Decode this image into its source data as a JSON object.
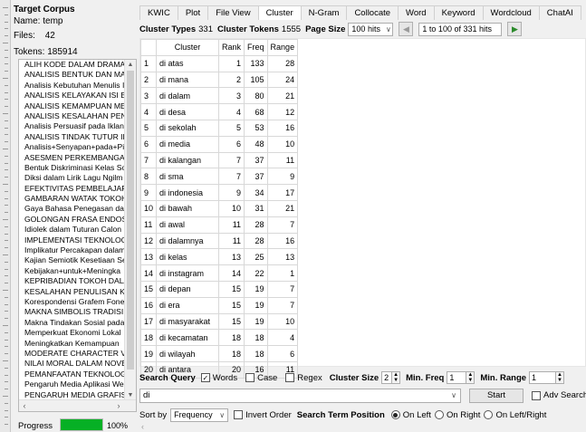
{
  "corpus": {
    "title": "Target Corpus",
    "name_label": "Name:",
    "name_value": "temp",
    "files_label": "Files:",
    "files_value": "42",
    "tokens_label": "Tokens:",
    "tokens_value": "185914",
    "files": [
      "ALIH KODE DALAM DRAMA",
      "ANALISIS BENTUK DAN MAK",
      "Analisis Kebutuhan Menulis I",
      "ANALISIS KELAYAKAN ISI BUI",
      "ANALISIS KEMAMPUAN MEI",
      "ANALISIS KESALAHAN PENG",
      "Analisis Persuasif pada Iklan",
      "ANALISIS TINDAK TUTUR ILO",
      "Analisis+Senyapan+pada+Pi",
      "ASESMEN PERKEMBANGAN",
      "Bentuk Diskriminasi Kelas So",
      "Diksi dalam Lirik Lagu Ngilm",
      "EFEKTIVITAS PEMBELAJARAN",
      "GAMBARAN WATAK TOKOH",
      "Gaya Bahasa Penegasan dala",
      "GOLONGAN FRASA ENDOSE",
      "Idiolek dalam Tuturan Calon",
      "IMPLEMENTASI TEKNOLOGI",
      "Implikatur Percakapan dalam",
      "Kajian Semiotik Kesetiaan Se",
      "Kebijakan+untuk+Meningka",
      "KEPRIBADIAN TOKOH DALAM",
      "KESALAHAN PENULISAN KAT",
      "Korespondensi Grafem Fone",
      "MAKNA SIMBOLIS TRADISI T",
      "Makna Tindakan Sosial pada",
      "Memperkuat Ekonomi Lokal",
      "Meningkatkan Kemampuan",
      "MODERATE CHARACTER VAL",
      "NILAI MORAL DALAM NOVE",
      "PEMANFAATAN TEKNOLOGI",
      "Pengaruh Media Aplikasi We",
      "PENGARUH MEDIA GRAFIS"
    ],
    "progress_label": "Progress",
    "progress_value": 100,
    "progress_text": "100%"
  },
  "tabs": [
    "KWIC",
    "Plot",
    "File View",
    "Cluster",
    "N-Gram",
    "Collocate",
    "Word",
    "Keyword",
    "Wordcloud",
    "ChatAI"
  ],
  "active_tab": "Cluster",
  "toolbar": {
    "types_label": "Cluster Types",
    "types_value": "331",
    "tokens_label": "Cluster Tokens",
    "tokens_value": "1555",
    "page_size_label": "Page Size",
    "page_size_value": "100 hits",
    "range_text": "1 to 100 of 331 hits"
  },
  "table": {
    "headers": [
      "",
      "Cluster",
      "Rank",
      "Freq",
      "Range"
    ],
    "rows": [
      [
        "1",
        "di atas",
        "1",
        "133",
        "28"
      ],
      [
        "2",
        "di mana",
        "2",
        "105",
        "24"
      ],
      [
        "3",
        "di dalam",
        "3",
        "80",
        "21"
      ],
      [
        "4",
        "di desa",
        "4",
        "68",
        "12"
      ],
      [
        "5",
        "di sekolah",
        "5",
        "53",
        "16"
      ],
      [
        "6",
        "di media",
        "6",
        "48",
        "10"
      ],
      [
        "7",
        "di kalangan",
        "7",
        "37",
        "11"
      ],
      [
        "8",
        "di sma",
        "7",
        "37",
        "9"
      ],
      [
        "9",
        "di indonesia",
        "9",
        "34",
        "17"
      ],
      [
        "10",
        "di bawah",
        "10",
        "31",
        "21"
      ],
      [
        "11",
        "di awal",
        "11",
        "28",
        "7"
      ],
      [
        "12",
        "di dalamnya",
        "11",
        "28",
        "16"
      ],
      [
        "13",
        "di kelas",
        "13",
        "25",
        "13"
      ],
      [
        "14",
        "di instagram",
        "14",
        "22",
        "1"
      ],
      [
        "15",
        "di depan",
        "15",
        "19",
        "7"
      ],
      [
        "16",
        "di era",
        "15",
        "19",
        "7"
      ],
      [
        "17",
        "di masyarakat",
        "15",
        "19",
        "10"
      ],
      [
        "18",
        "di kecamatan",
        "18",
        "18",
        "4"
      ],
      [
        "19",
        "di wilayah",
        "18",
        "18",
        "6"
      ],
      [
        "20",
        "di antara",
        "20",
        "16",
        "11"
      ]
    ]
  },
  "search": {
    "query_label": "Search Query",
    "words_label": "Words",
    "case_label": "Case",
    "regex_label": "Regex",
    "cluster_size_label": "Cluster Size",
    "cluster_size_value": "2",
    "min_freq_label": "Min. Freq",
    "min_freq_value": "1",
    "min_range_label": "Min. Range",
    "min_range_value": "1",
    "query_value": "di",
    "start_label": "Start",
    "adv_label": "Adv Search"
  },
  "sort": {
    "label": "Sort by",
    "value": "Frequency",
    "invert_label": "Invert Order",
    "position_label": "Search Term Position",
    "on_left": "On Left",
    "on_right": "On Right",
    "on_left_right": "On Left/Right"
  },
  "icons": {
    "back": "arrow-left-icon",
    "go": "arrow-right-icon",
    "check": "checkmark-icon",
    "dropdown": "chevron-down-icon"
  },
  "colors": {
    "progress": "#06b025",
    "panel": "#f0f0f0",
    "go_icon": "#2a8a2a"
  }
}
